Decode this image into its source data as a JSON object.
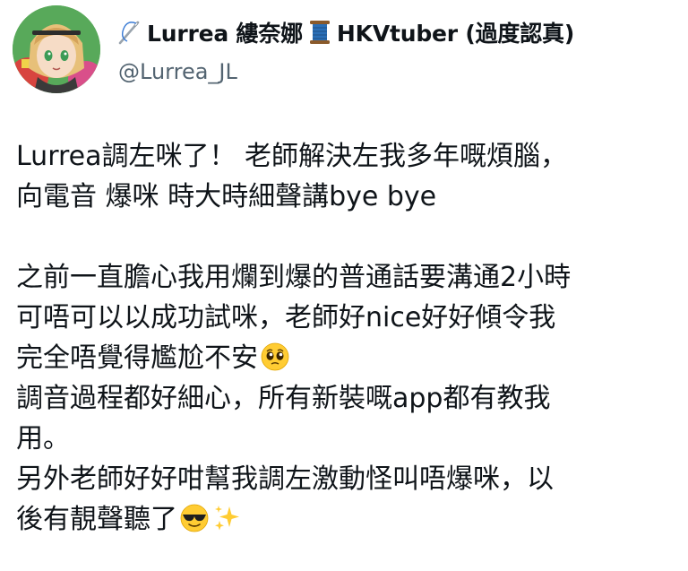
{
  "author": {
    "name_prefix": "Lurrea 縷奈娜",
    "name_suffix": "HKVtuber (過度認真)",
    "handle": "@Lurrea_JL",
    "icons": [
      "sewing-needle-icon",
      "thread-spool-icon"
    ]
  },
  "tweet": {
    "lines": [
      "Lurrea調左咪了！ 老師解決左我多年嘅煩腦，",
      "向電音 爆咪 時大時細聲講bye bye",
      "",
      "之前一直膽心我用爛到爆的普通話要溝通2小時",
      "可唔可以以成功試咪，老師好nice好好傾令我",
      "完全唔覺得尷尬不安",
      "調音過程都好細心，所有新裝嘅app都有教我",
      "用。",
      "另外老師好好咁幫我調左激動怪叫唔爆咪，以",
      "後有靚聲聽了"
    ],
    "emojis": {
      "line5": "pleading-face-icon",
      "line9": [
        "sunglasses-face-icon",
        "sparkles-icon"
      ]
    }
  },
  "colors": {
    "text": "#0f1419",
    "secondary": "#536471",
    "emoji_yellow": "#ffcc33",
    "spool_blue": "#2a6fb7"
  }
}
